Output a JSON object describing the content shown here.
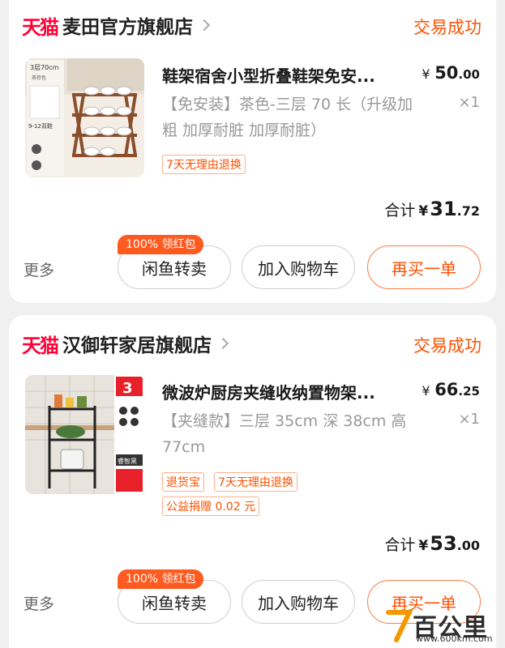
{
  "orders": [
    {
      "store_brand": "天猫",
      "store_name": "麦田官方旗舰店",
      "status": "交易成功",
      "product": {
        "title": "鞋架宿舍小型折叠鞋架免安...",
        "price_symbol": "¥",
        "price_int": "50",
        "price_dec": ".00",
        "spec": "【免安装】茶色-三层 70 长（升级加粗 加厚耐脏 加厚耐脏）",
        "qty": "×1",
        "thumb_labels": [
          "3层70cm",
          "茶棕色",
          "9-12双鞋"
        ],
        "tags": [
          "7天无理由退换"
        ]
      },
      "total_label": "合计",
      "total_symbol": "¥",
      "total_int": "31",
      "total_dec": ".72",
      "more_label": "更多",
      "promo_badge": "100% 领红包",
      "buttons": [
        "闲鱼转卖",
        "加入购物车",
        "再买一单"
      ]
    },
    {
      "store_brand": "天猫",
      "store_name": "汉御轩家居旗舰店",
      "status": "交易成功",
      "product": {
        "title": "微波炉厨房夹缝收纳置物架...",
        "price_symbol": "¥",
        "price_int": "66",
        "price_dec": ".25",
        "spec": "【夹缝款】三层 35cm 深 38cm 高 77cm",
        "qty": "×1",
        "thumb_labels": [
          "3",
          "睿智黑"
        ],
        "tags": [
          "退货宝",
          "7天无理由退换",
          "公益捐赠 0.02 元"
        ]
      },
      "total_label": "合计",
      "total_symbol": "¥",
      "total_int": "53",
      "total_dec": ".00",
      "more_label": "更多",
      "promo_badge": "100% 领红包",
      "buttons": [
        "闲鱼转卖",
        "加入购物车",
        "再买一单"
      ]
    }
  ],
  "watermark": {
    "text": "百公里",
    "url": "www.600km.com"
  },
  "colors": {
    "accent": "#ff5000",
    "tmall_red": "#ff0036",
    "background": "#f0f0f0"
  }
}
